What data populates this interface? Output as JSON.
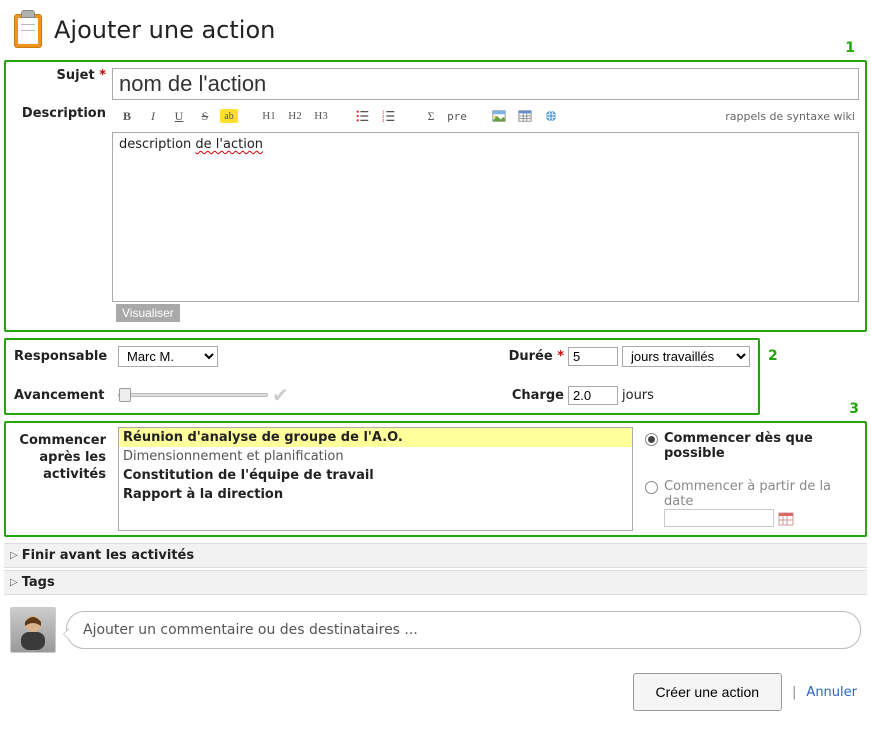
{
  "header": {
    "title": "Ajouter une action"
  },
  "box1": {
    "subject_label": "Sujet",
    "subject_value": "nom de l'action",
    "description_label": "Description",
    "toolbar": {
      "bold": "B",
      "italic": "I",
      "underline": "U",
      "strike": "S",
      "highlight": "ab",
      "h1": "H1",
      "h2": "H2",
      "h3": "H3",
      "sigma": "Σ",
      "pre": "pre",
      "wiki_help": "rappels de syntaxe wiki"
    },
    "description_pre": "description ",
    "description_err": "de l'action",
    "visualize": "Visualiser",
    "num": "1"
  },
  "box2": {
    "responsible_label": "Responsable",
    "responsible_value": "Marc M.",
    "progress_label": "Avancement",
    "duration_label": "Durée",
    "duration_value": "5",
    "duration_unit": "jours travaillés",
    "load_label": "Charge",
    "load_value": "2.0",
    "load_unit": "jours",
    "num": "2"
  },
  "box3": {
    "start_after_label_l1": "Commencer",
    "start_after_label_l2": "après les",
    "start_after_label_l3": "activités",
    "items": [
      "Réunion d'analyse de groupe de l'A.O.",
      "Dimensionnement et planification",
      "Constitution de l'équipe de travail",
      "Rapport à la direction"
    ],
    "opt_asap": "Commencer dès que possible",
    "opt_from": "Commencer à partir de la date",
    "num": "3"
  },
  "bars": {
    "finish_before": "Finir avant les activités",
    "tags": "Tags"
  },
  "comment": {
    "placeholder": "Ajouter un commentaire ou des destinataires ..."
  },
  "footer": {
    "create": "Créer une action",
    "cancel": "Annuler"
  }
}
